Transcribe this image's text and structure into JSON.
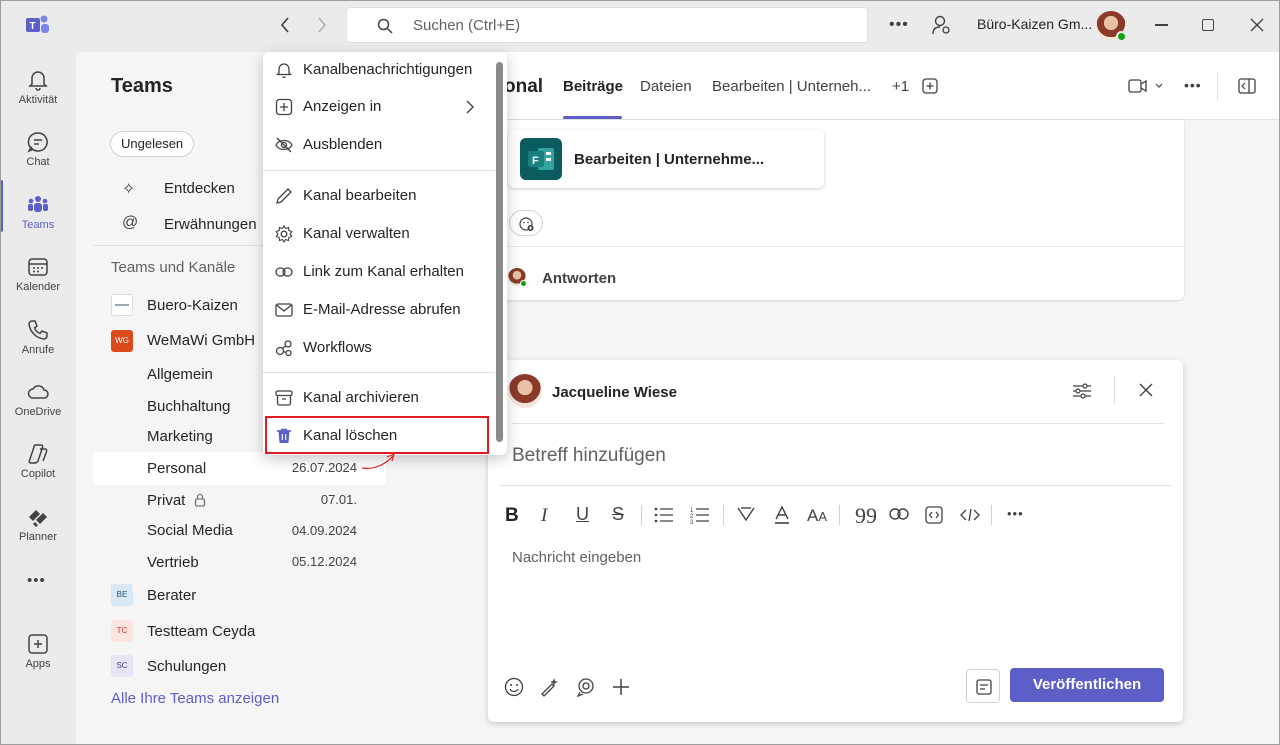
{
  "titlebar": {
    "search_placeholder": "Suchen (Ctrl+E)",
    "account_name": "Büro-Kaizen Gm..."
  },
  "rail": [
    {
      "label": "Aktivität",
      "icon": "bell-icon"
    },
    {
      "label": "Chat",
      "icon": "chat-icon"
    },
    {
      "label": "Teams",
      "icon": "teams-icon"
    },
    {
      "label": "Kalender",
      "icon": "calendar-icon"
    },
    {
      "label": "Anrufe",
      "icon": "phone-icon"
    },
    {
      "label": "OneDrive",
      "icon": "cloud-icon"
    },
    {
      "label": "Copilot",
      "icon": "copilot-icon"
    },
    {
      "label": "Planner",
      "icon": "planner-icon"
    },
    {
      "label": "Apps",
      "icon": "apps-icon"
    }
  ],
  "panel": {
    "title": "Teams",
    "filter_chip": "Ungelesen",
    "nav": [
      {
        "label": "Entdecken",
        "icon": "sparkle-icon"
      },
      {
        "label": "Erwähnungen",
        "icon": "at-icon"
      }
    ],
    "section_title": "Teams und Kanäle",
    "teams": [
      {
        "name": "Buero-Kaizen",
        "avatar": "",
        "color": "#ffffff"
      },
      {
        "name": "WeMaWi GmbH",
        "avatar": "WG",
        "color": "#dc4a1c"
      },
      {
        "name": "Berater",
        "avatar": "BE",
        "color": "#d9e8f5"
      },
      {
        "name": "Testteam Ceyda",
        "avatar": "TC",
        "color": "#fde4e0"
      },
      {
        "name": "Schulungen",
        "avatar": "SC",
        "color": "#e8e3f5"
      }
    ],
    "channels": [
      {
        "name": "Allgemein",
        "date": ""
      },
      {
        "name": "Buchhaltung",
        "date": ""
      },
      {
        "name": "Marketing",
        "date": ""
      },
      {
        "name": "Personal",
        "date": "26.07.2024"
      },
      {
        "name": "Privat",
        "date": "07.01."
      },
      {
        "name": "Social Media",
        "date": "04.09.2024"
      },
      {
        "name": "Vertrieb",
        "date": "05.12.2024"
      }
    ],
    "show_all_link": "Alle Ihre Teams anzeigen"
  },
  "header": {
    "channel_title_fragment": "onal",
    "tabs": [
      "Beiträge",
      "Dateien",
      "Bearbeiten | Unterneh...",
      "+1"
    ]
  },
  "post": {
    "app_card_title": "Bearbeiten | Unternehme...",
    "reply_label": "Antworten"
  },
  "compose": {
    "author": "Jacqueline Wiese",
    "subject_placeholder": "Betreff hinzufügen",
    "message_placeholder": "Nachricht eingeben",
    "publish_label": "Veröffentlichen"
  },
  "menu": {
    "items": [
      {
        "label": "Kanalbenachrichtigungen",
        "icon": "bell-icon"
      },
      {
        "label": "Anzeigen in",
        "icon": "plus-square-icon"
      },
      {
        "label": "Ausblenden",
        "icon": "eye-off-icon"
      },
      {
        "label": "Kanal bearbeiten",
        "icon": "pencil-icon"
      },
      {
        "label": "Kanal verwalten",
        "icon": "gear-icon"
      },
      {
        "label": "Link zum Kanal erhalten",
        "icon": "link-icon"
      },
      {
        "label": "E-Mail-Adresse abrufen",
        "icon": "mail-icon"
      },
      {
        "label": "Workflows",
        "icon": "workflow-icon"
      },
      {
        "label": "Kanal archivieren",
        "icon": "archive-icon"
      },
      {
        "label": "Kanal löschen",
        "icon": "trash-icon"
      }
    ],
    "highlight_color": "#e01b24"
  },
  "colors": {
    "accent": "#5b5fc7",
    "background": "#ebebeb"
  }
}
